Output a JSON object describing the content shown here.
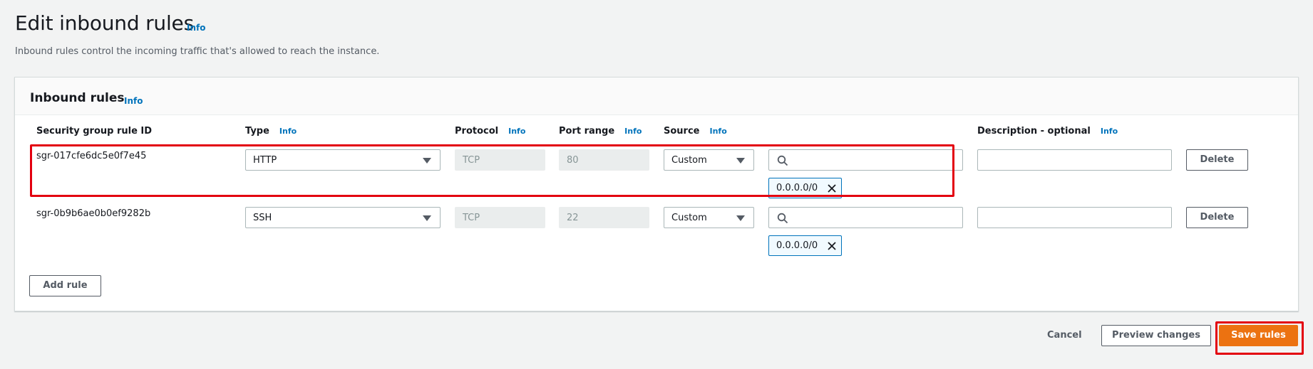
{
  "header": {
    "title": "Edit inbound rules",
    "info": "Info",
    "description": "Inbound rules control the incoming traffic that's allowed to reach the instance."
  },
  "panel": {
    "title": "Inbound rules",
    "info": "Info",
    "columns": {
      "rule_id": "Security group rule ID",
      "type": "Type",
      "protocol": "Protocol",
      "port_range": "Port range",
      "source": "Source",
      "description": "Description - optional",
      "info": "Info"
    },
    "rules": [
      {
        "id": "sgr-017cfe6dc5e0f7e45",
        "type": "HTTP",
        "protocol": "TCP",
        "port_range": "80",
        "source": "Custom",
        "search_value": "",
        "cidr": "0.0.0.0/0",
        "description": "",
        "delete_label": "Delete"
      },
      {
        "id": "sgr-0b9b6ae0b0ef9282b",
        "type": "SSH",
        "protocol": "TCP",
        "port_range": "22",
        "source": "Custom",
        "search_value": "",
        "cidr": "0.0.0.0/0",
        "description": "",
        "delete_label": "Delete"
      }
    ],
    "add_rule_label": "Add rule"
  },
  "footer": {
    "cancel_label": "Cancel",
    "preview_label": "Preview changes",
    "save_label": "Save rules"
  },
  "colors": {
    "accent": "#ec7211",
    "info_link": "#0073bb",
    "highlight": "#e3000f"
  }
}
